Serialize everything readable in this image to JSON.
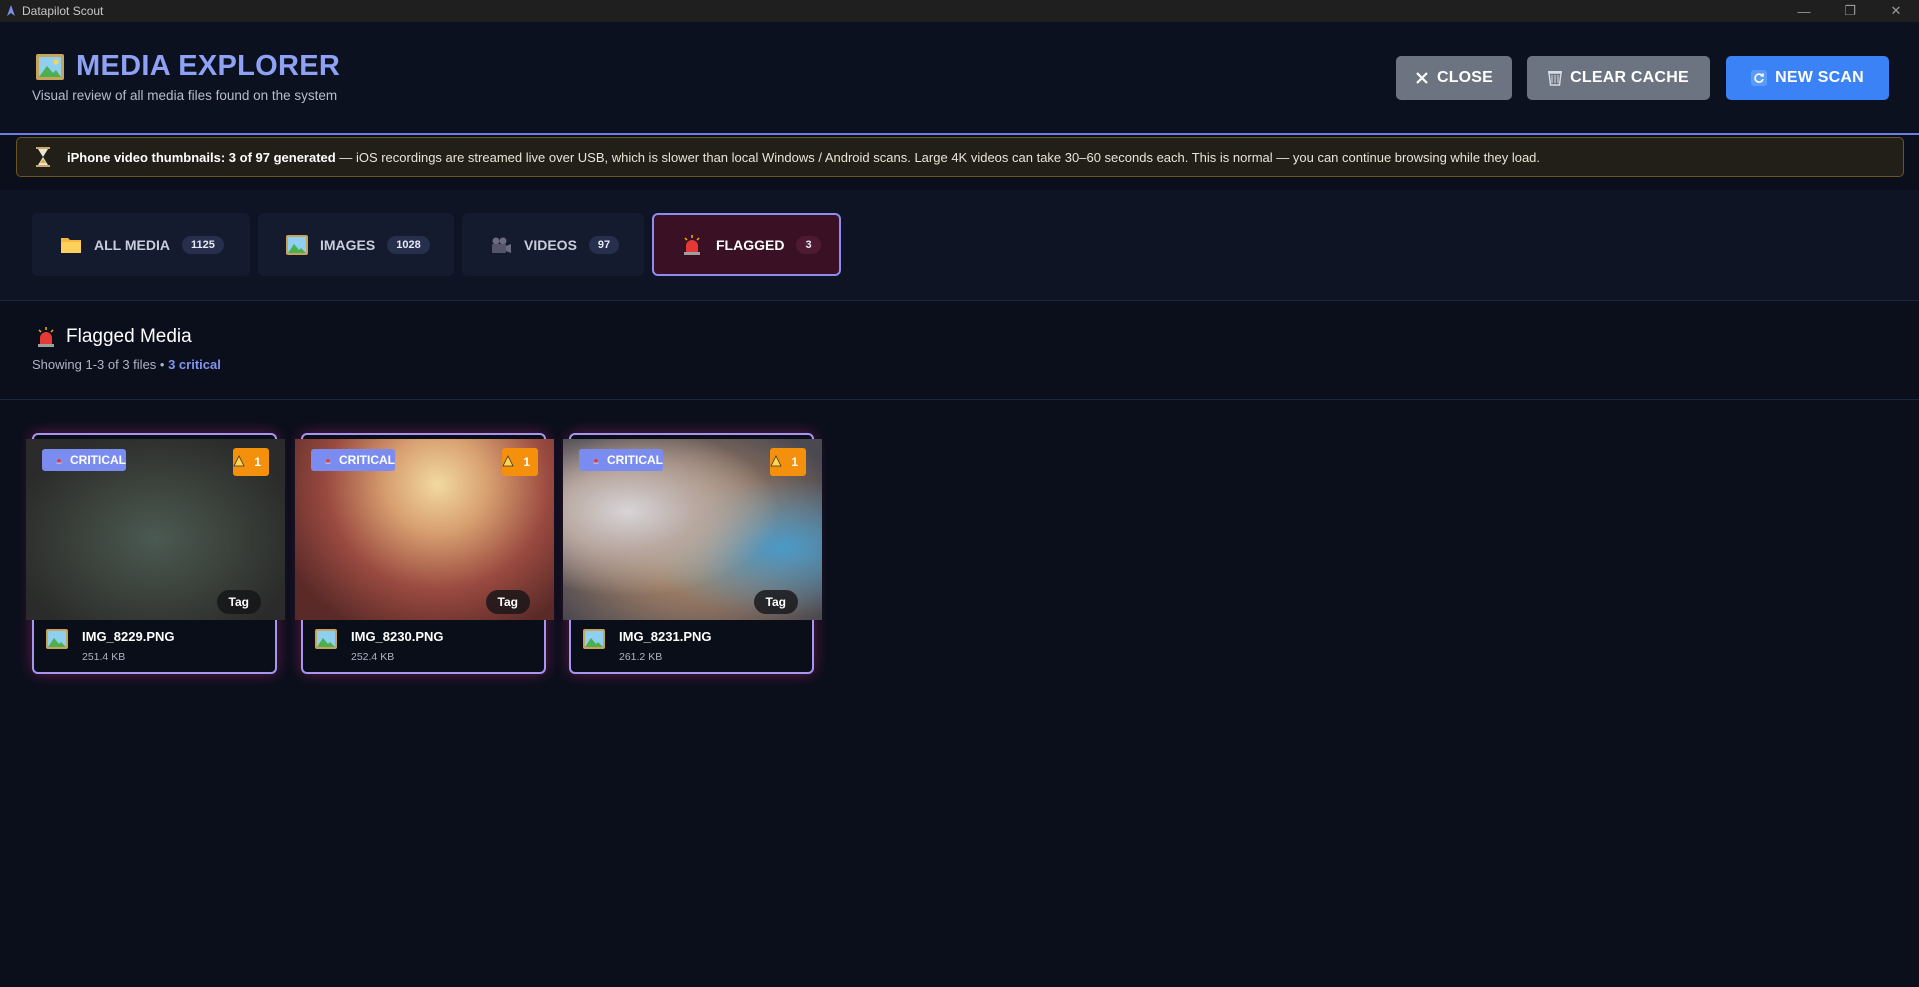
{
  "window": {
    "title": "Datapilot Scout",
    "controls": [
      "—",
      "❐",
      "✕"
    ]
  },
  "header": {
    "title": "MEDIA EXPLORER",
    "subtitle": "Visual review of all media files found on the system",
    "buttons": {
      "close": "CLOSE",
      "clear_cache": "CLEAR CACHE",
      "new_scan": "NEW SCAN"
    }
  },
  "banner": {
    "bold": "iPhone video thumbnails: 3 of 97 generated",
    "text": " — iOS recordings are streamed live over USB, which is slower than local Windows / Android scans. Large 4K videos can take 30–60 seconds each. This is normal — you can continue browsing while they load."
  },
  "tabs": [
    {
      "label": "ALL MEDIA",
      "count": "1125",
      "icon": "folder-icon"
    },
    {
      "label": "IMAGES",
      "count": "1028",
      "icon": "picture-icon"
    },
    {
      "label": "VIDEOS",
      "count": "97",
      "icon": "video-camera-icon"
    },
    {
      "label": "FLAGGED",
      "count": "3",
      "icon": "siren-icon",
      "active": true
    }
  ],
  "section": {
    "title": "Flagged Media",
    "showing": "Showing 1-3 of 3 files • ",
    "critical": "3 critical"
  },
  "cards": [
    {
      "badge": "CRITICAL",
      "warn_count": "1",
      "tag": "Tag",
      "filename": "IMG_8229.PNG",
      "size": "251.4 KB"
    },
    {
      "badge": "CRITICAL",
      "warn_count": "1",
      "tag": "Tag",
      "filename": "IMG_8230.PNG",
      "size": "252.4 KB"
    },
    {
      "badge": "CRITICAL",
      "warn_count": "1",
      "tag": "Tag",
      "filename": "IMG_8231.PNG",
      "size": "261.2 KB"
    }
  ],
  "colors": {
    "accent": "#8ea1f5",
    "primary_button": "#3b82f6",
    "secondary_button": "#6b7480",
    "critical_badge": "#7b8cf0",
    "warning_badge": "#f4900c",
    "flagged_tab_bg": "#3a1024"
  }
}
